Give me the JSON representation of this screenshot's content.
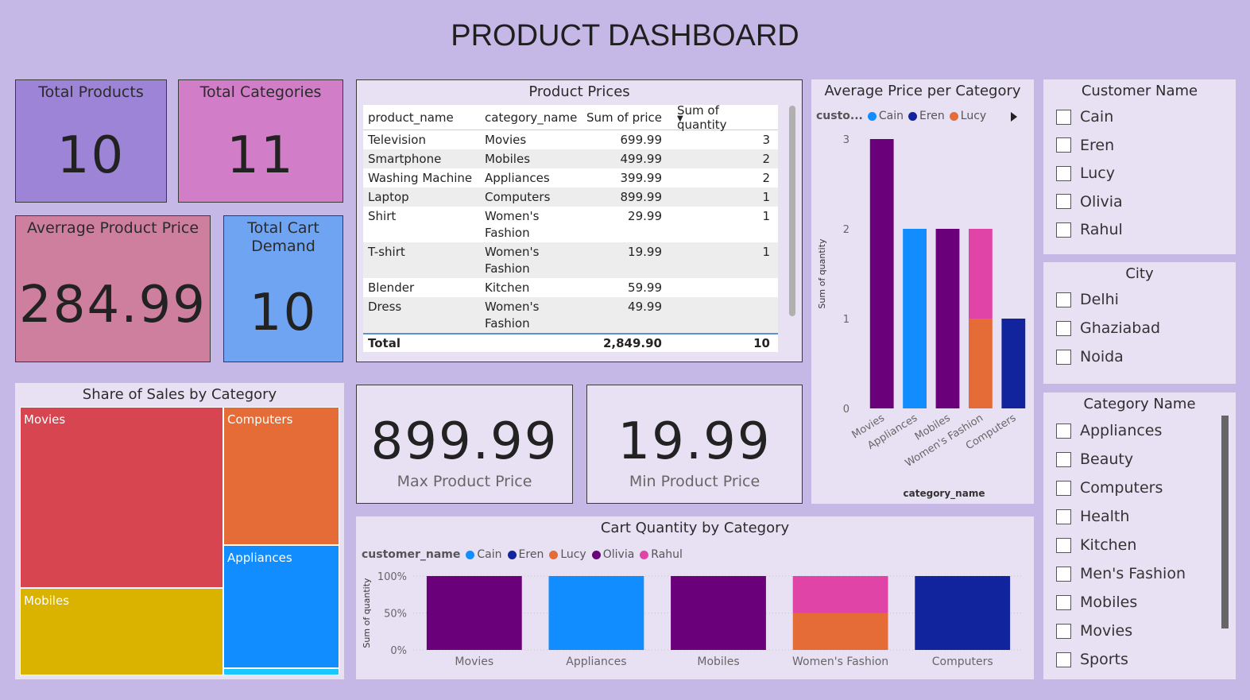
{
  "title": "PRODUCT DASHBOARD",
  "cards": {
    "total_products": {
      "label": "Total Products",
      "value": "10"
    },
    "total_categories": {
      "label": "Total Categories",
      "value": "11"
    },
    "avg_price": {
      "label": "Averrage Product Price",
      "value": "284.99"
    },
    "cart_demand": {
      "label": "Total Cart Demand",
      "value": "10"
    },
    "max_price": {
      "label": "Max Product Price",
      "value": "899.99"
    },
    "min_price": {
      "label": "Min Product Price",
      "value": "19.99"
    }
  },
  "product_prices": {
    "title": "Product Prices",
    "columns": [
      "product_name",
      "category_name",
      "Sum of price",
      "Sum of quantity"
    ],
    "rows": [
      [
        "Television",
        "Movies",
        "699.99",
        "3"
      ],
      [
        "Smartphone",
        "Mobiles",
        "499.99",
        "2"
      ],
      [
        "Washing Machine",
        "Appliances",
        "399.99",
        "2"
      ],
      [
        "Laptop",
        "Computers",
        "899.99",
        "1"
      ],
      [
        "Shirt",
        "Women's Fashion",
        "29.99",
        "1"
      ],
      [
        "T-shirt",
        "Women's Fashion",
        "19.99",
        "1"
      ],
      [
        "Blender",
        "Kitchen",
        "59.99",
        ""
      ],
      [
        "Dress",
        "Women's Fashion",
        "49.99",
        ""
      ]
    ],
    "total": [
      "Total",
      "",
      "2,849.90",
      "10"
    ]
  },
  "colors": {
    "Cain": "#118dff",
    "Eren": "#12239e",
    "Lucy": "#e66c37",
    "Olivia": "#6b007b",
    "Rahul": "#e044a7"
  },
  "treemap": {
    "title": "Share of Sales by Category",
    "items": [
      {
        "label": "Movies",
        "color": "#d64550"
      },
      {
        "label": "Computers",
        "color": "#e66c37"
      },
      {
        "label": "Mobiles",
        "color": "#d9b300"
      },
      {
        "label": "Appliances",
        "color": "#118dff"
      },
      {
        "label": "",
        "color": "#1ac6ff"
      }
    ]
  },
  "avg_chart": {
    "title": "Average Price per Category",
    "legend_title": "custo...",
    "legend_next_icon": "triangle-right-icon",
    "ylabel": "Sum of quantity",
    "xlabel": "category_name",
    "yticks": [
      "0",
      "1",
      "2",
      "3"
    ]
  },
  "cart_chart": {
    "title": "Cart Quantity by Category",
    "legend_title": "customer_name",
    "ylabel": "Sum of quantity",
    "yticks": [
      "0%",
      "50%",
      "100%"
    ]
  },
  "chart_data": [
    {
      "type": "bar",
      "title": "Average Price per Category",
      "xlabel": "category_name",
      "ylabel": "Sum of quantity",
      "ylim": [
        0,
        3
      ],
      "categories": [
        "Movies",
        "Appliances",
        "Mobiles",
        "Women's Fashion",
        "Computers"
      ],
      "legend": [
        "Cain",
        "Eren",
        "Lucy"
      ],
      "series": [
        {
          "name": "Olivia",
          "values": [
            3,
            0,
            2,
            0,
            0
          ]
        },
        {
          "name": "Cain",
          "values": [
            0,
            2,
            0,
            0,
            0
          ]
        },
        {
          "name": "Lucy",
          "values": [
            0,
            0,
            0,
            1,
            0
          ]
        },
        {
          "name": "Rahul",
          "values": [
            0,
            0,
            0,
            1,
            0
          ]
        },
        {
          "name": "Eren",
          "values": [
            0,
            0,
            0,
            0,
            1
          ]
        }
      ],
      "stacked": true
    },
    {
      "type": "bar",
      "title": "Cart Quantity by Category",
      "ylabel": "Sum of quantity",
      "ylim": [
        0,
        100
      ],
      "categories": [
        "Movies",
        "Appliances",
        "Mobiles",
        "Women's Fashion",
        "Computers"
      ],
      "legend": [
        "Cain",
        "Eren",
        "Lucy",
        "Olivia",
        "Rahul"
      ],
      "series": [
        {
          "name": "Olivia",
          "values": [
            100,
            0,
            100,
            0,
            0
          ]
        },
        {
          "name": "Cain",
          "values": [
            0,
            100,
            0,
            0,
            0
          ]
        },
        {
          "name": "Lucy",
          "values": [
            0,
            0,
            0,
            50,
            0
          ]
        },
        {
          "name": "Rahul",
          "values": [
            0,
            0,
            0,
            50,
            0
          ]
        },
        {
          "name": "Eren",
          "values": [
            0,
            0,
            0,
            0,
            100
          ]
        }
      ],
      "stacked": true
    }
  ],
  "slicers": {
    "customer": {
      "title": "Customer Name",
      "items": [
        "Cain",
        "Eren",
        "Lucy",
        "Olivia",
        "Rahul"
      ]
    },
    "city": {
      "title": "City",
      "items": [
        "Delhi",
        "Ghaziabad",
        "Noida"
      ]
    },
    "category": {
      "title": "Category Name",
      "items": [
        "Appliances",
        "Beauty",
        "Computers",
        "Health",
        "Kitchen",
        "Men's Fashion",
        "Mobiles",
        "Movies",
        "Sports"
      ]
    }
  }
}
